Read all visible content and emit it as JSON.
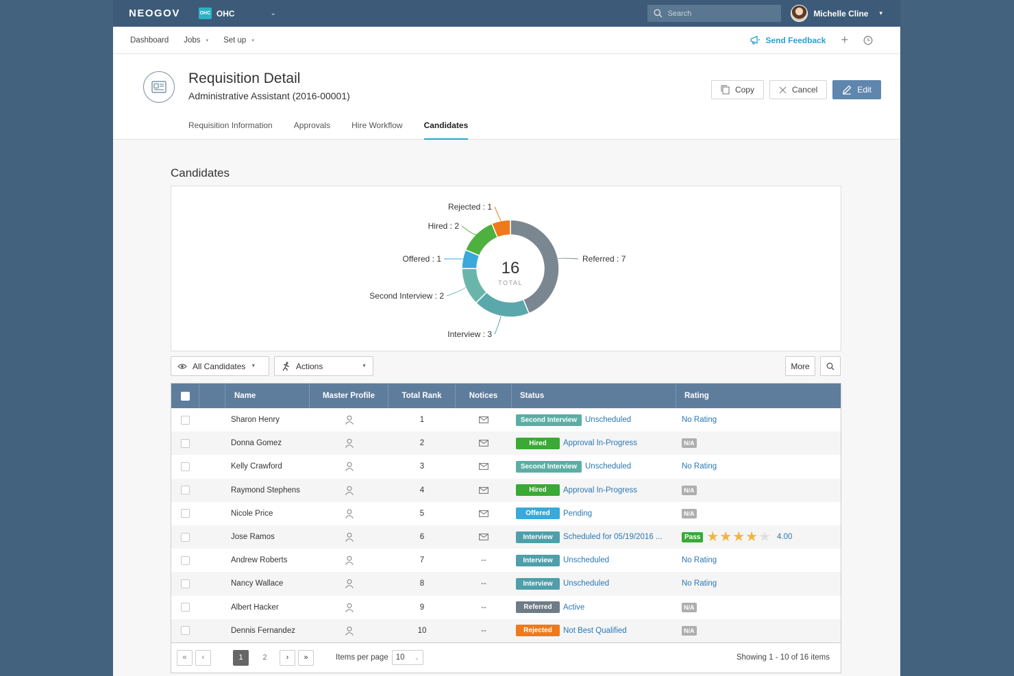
{
  "topbar": {
    "logo": "NEOGOV",
    "org_badge": "OHC",
    "org_name": "OHC",
    "search_placeholder": "Search",
    "user_name": "Michelle Cline"
  },
  "nav": {
    "items": [
      "Dashboard",
      "Jobs",
      "Set up"
    ],
    "feedback": "Send Feedback"
  },
  "header": {
    "title": "Requisition Detail",
    "subtitle": "Administrative Assistant (2016-00001)",
    "buttons": {
      "copy": "Copy",
      "cancel": "Cancel",
      "edit": "Edit"
    },
    "tabs": [
      "Requisition Information",
      "Approvals",
      "Hire Workflow",
      "Candidates"
    ],
    "active_tab": "Candidates"
  },
  "section_title": "Candidates",
  "chart_data": {
    "type": "pie",
    "total_value": "16",
    "total_label": "TOTAL",
    "slices": [
      {
        "name": "Referred",
        "value": 7,
        "color": "#7a8690",
        "label": "Referred : 7"
      },
      {
        "name": "Interview",
        "value": 3,
        "color": "#5aa8ac",
        "label": "Interview : 3"
      },
      {
        "name": "Second Interview",
        "value": 2,
        "color": "#6ab5aa",
        "label": "Second Interview : 2"
      },
      {
        "name": "Offered",
        "value": 1,
        "color": "#38a9d9",
        "label": "Offered : 1"
      },
      {
        "name": "Hired",
        "value": 2,
        "color": "#4eb03f",
        "label": "Hired : 2"
      },
      {
        "name": "Rejected",
        "value": 1,
        "color": "#ee7a1c",
        "label": "Rejected : 1"
      }
    ]
  },
  "toolbar": {
    "filter": "All Candidates",
    "actions": "Actions",
    "more": "More"
  },
  "grid": {
    "columns": [
      "Name",
      "Master Profile",
      "Total Rank",
      "Notices",
      "Status",
      "Rating"
    ],
    "rows": [
      {
        "name": "Sharon Henry",
        "rank": "1",
        "notice": "mail",
        "notice_text": "",
        "badge": "Second Interview",
        "badge_color": "#5aaea4",
        "status": "Unscheduled",
        "rating": "No Rating",
        "rating_type": "text"
      },
      {
        "name": "Donna Gomez",
        "rank": "2",
        "notice": "mail",
        "notice_text": "",
        "badge": "Hired",
        "badge_color": "#3aa935",
        "status": "Approval In-Progress",
        "rating": "N/A",
        "rating_type": "na"
      },
      {
        "name": "Kelly Crawford",
        "rank": "3",
        "notice": "mail",
        "notice_text": "",
        "badge": "Second Interview",
        "badge_color": "#5aaea4",
        "status": "Unscheduled",
        "rating": "No Rating",
        "rating_type": "text"
      },
      {
        "name": "Raymond Stephens",
        "rank": "4",
        "notice": "mail",
        "notice_text": "",
        "badge": "Hired",
        "badge_color": "#3aa935",
        "status": "Approval In-Progress",
        "rating": "N/A",
        "rating_type": "na"
      },
      {
        "name": "Nicole Price",
        "rank": "5",
        "notice": "mail",
        "notice_text": "",
        "badge": "Offered",
        "badge_color": "#38a9d9",
        "status": "Pending",
        "rating": "N/A",
        "rating_type": "na"
      },
      {
        "name": "Jose Ramos",
        "rank": "6",
        "notice": "mail",
        "notice_text": "",
        "badge": "Interview",
        "badge_color": "#4e9fa9",
        "status": "Scheduled for 05/19/2016 ...",
        "rating": "4.00",
        "rating_type": "stars",
        "pass": "Pass",
        "stars": 4
      },
      {
        "name": "Andrew Roberts",
        "rank": "7",
        "notice": "none",
        "notice_text": "--",
        "badge": "Interview",
        "badge_color": "#4e9fa9",
        "status": "Unscheduled",
        "rating": "No Rating",
        "rating_type": "text"
      },
      {
        "name": "Nancy Wallace",
        "rank": "8",
        "notice": "none",
        "notice_text": "--",
        "badge": "Interview",
        "badge_color": "#4e9fa9",
        "status": "Unscheduled",
        "rating": "No Rating",
        "rating_type": "text"
      },
      {
        "name": "Albert Hacker",
        "rank": "9",
        "notice": "none",
        "notice_text": "--",
        "badge": "Referred",
        "badge_color": "#6f7b86",
        "status": "Active",
        "rating": "N/A",
        "rating_type": "na"
      },
      {
        "name": "Dennis Fernandez",
        "rank": "10",
        "notice": "none",
        "notice_text": "--",
        "badge": "Rejected",
        "badge_color": "#ee7a1c",
        "status": "Not Best Qualified",
        "rating": "N/A",
        "rating_type": "na"
      }
    ]
  },
  "pager": {
    "pages": [
      "1",
      "2"
    ],
    "current": "1",
    "items_per_page_label": "Items per page",
    "items_per_page": "10",
    "showing": "Showing 1 - 10 of 16 items"
  }
}
